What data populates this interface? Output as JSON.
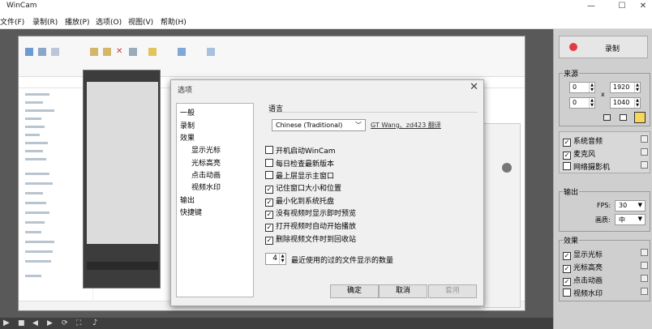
{
  "window": {
    "title": "WinCam",
    "minimize": "—",
    "maximize": "☐",
    "close": "✕"
  },
  "menu": [
    "文件(F)",
    "录制(R)",
    "播放(P)",
    "选项(O)",
    "视图(V)",
    "帮助(H)"
  ],
  "dialog": {
    "title": "选项",
    "close": "✕",
    "tree": [
      {
        "label": "一般",
        "indent": 0
      },
      {
        "label": "录制",
        "indent": 0
      },
      {
        "label": "效果",
        "indent": 0
      },
      {
        "label": "显示光标",
        "indent": 1
      },
      {
        "label": "光标高亮",
        "indent": 1
      },
      {
        "label": "点击动画",
        "indent": 1
      },
      {
        "label": "视频水印",
        "indent": 1
      },
      {
        "label": "输出",
        "indent": 0
      },
      {
        "label": "快捷键",
        "indent": 0
      }
    ],
    "language_label": "语言",
    "language_value": "Chinese (Traditional)",
    "language_credit": "GT Wang、zd423 翻译",
    "checkboxes": [
      {
        "label": "开机启动WinCam",
        "checked": false
      },
      {
        "label": "每日检查最新版本",
        "checked": false
      },
      {
        "label": "最上层显示主窗口",
        "checked": false
      },
      {
        "label": "记住窗口大小和位置",
        "checked": true
      },
      {
        "label": "最小化到系统托盘",
        "checked": true
      },
      {
        "label": "没有视频时显示即时预览",
        "checked": true
      },
      {
        "label": "打开视频时自动开始播放",
        "checked": true
      },
      {
        "label": "删除视频文件时到回收站",
        "checked": true
      }
    ],
    "recent_count": "4",
    "recent_label": "最近使用的过的文件显示的数量",
    "buttons": {
      "ok": "确定",
      "cancel": "取消",
      "apply": "套用"
    }
  },
  "sidebar": {
    "record_label": "录制",
    "source_label": "来源",
    "source_x": "0",
    "source_y": "0",
    "source_w": "1920",
    "source_h": "1040",
    "times": "x",
    "source_checks": [
      {
        "label": "系统音频",
        "checked": true
      },
      {
        "label": "麦克风",
        "checked": true
      },
      {
        "label": "网络摄影机",
        "checked": false
      }
    ],
    "output_label": "输出",
    "fps_label": "FPS:",
    "fps_value": "30",
    "quality_label": "画质:",
    "quality_value": "中",
    "effects_label": "效果",
    "effect_checks": [
      {
        "label": "显示光标",
        "checked": true
      },
      {
        "label": "光标高亮",
        "checked": true
      },
      {
        "label": "点击动画",
        "checked": true
      },
      {
        "label": "视频水印",
        "checked": false
      }
    ]
  },
  "colors": {
    "record_dot": "#e23a44",
    "dark_bg": "#595959",
    "panel_bg": "#cfcfcf"
  }
}
